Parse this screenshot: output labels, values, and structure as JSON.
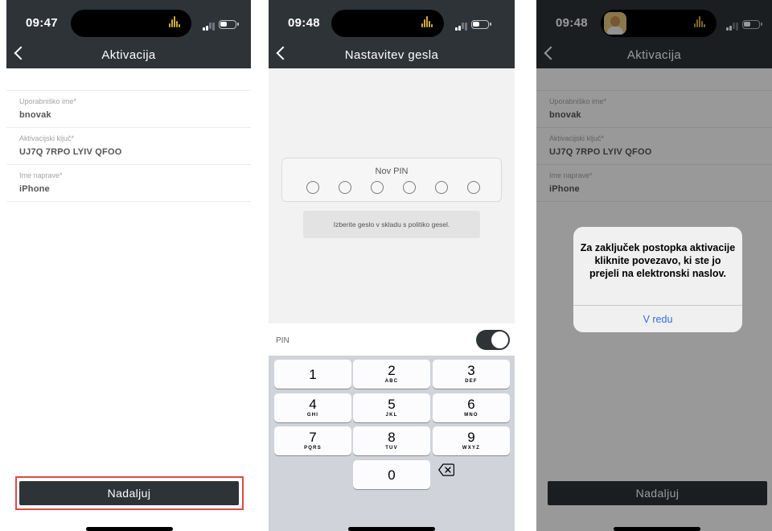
{
  "screen1": {
    "time": "09:47",
    "title": "Aktivacija",
    "fields": [
      {
        "label": "Uporabniško ime*",
        "value": "bnovak"
      },
      {
        "label": "Aktivacijski ključ*",
        "value": "UJ7Q 7RPO LYIV QFOO"
      },
      {
        "label": "Ime naprave*",
        "value": "iPhone"
      }
    ],
    "button_label": "Nadaljuj",
    "icons": {
      "back": "chevron-left-icon",
      "signal": "signal-icon",
      "battery": "battery-icon",
      "audio": "waveform-icon"
    }
  },
  "screen2": {
    "time": "09:48",
    "title": "Nastavitev gesla",
    "pin_title": "Nov PIN",
    "pin_length": 6,
    "hint": "Izberite geslo v skladu s politiko gesel.",
    "pin_toggle_label": "PIN",
    "pin_toggle_on": true,
    "keys": [
      {
        "digit": "1",
        "letters": ""
      },
      {
        "digit": "2",
        "letters": "ABC"
      },
      {
        "digit": "3",
        "letters": "DEF"
      },
      {
        "digit": "4",
        "letters": "GHI"
      },
      {
        "digit": "5",
        "letters": "JKL"
      },
      {
        "digit": "6",
        "letters": "MNO"
      },
      {
        "digit": "7",
        "letters": "PQRS"
      },
      {
        "digit": "8",
        "letters": "TUV"
      },
      {
        "digit": "9",
        "letters": "WXYZ"
      },
      {
        "digit": "0",
        "letters": ""
      }
    ],
    "delete_icon": "delete-backspace-icon"
  },
  "screen3": {
    "time": "09:48",
    "title": "Aktivacija",
    "fields": [
      {
        "label": "Uporabniško ime*",
        "value": "bnovak"
      },
      {
        "label": "Aktivacijski ključ*",
        "value": "UJ7Q 7RPO LYIV QFOO"
      },
      {
        "label": "Ime naprave*",
        "value": "iPhone"
      }
    ],
    "button_label": "Nadaljuj",
    "alert_message": "Za zaključek postopka aktivacije kliknite povezavo, ki ste jo prejeli na elektronski naslov.",
    "alert_button": "V redu"
  },
  "colors": {
    "bar": "#2e3338",
    "highlight": "#e34848",
    "link": "#2f6fdb",
    "accent": "#d4ac3d"
  }
}
